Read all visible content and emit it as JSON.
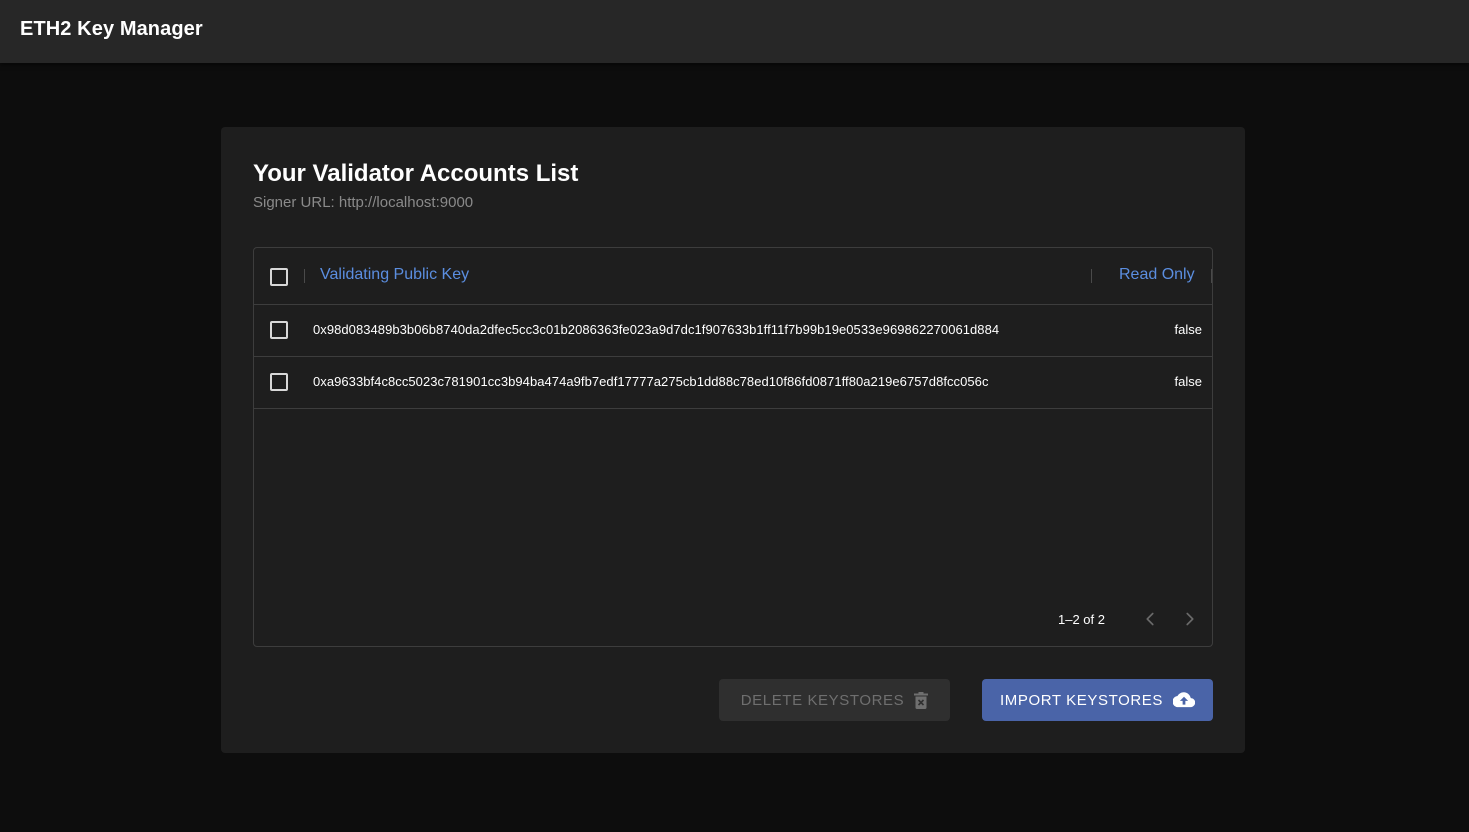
{
  "app": {
    "title": "ETH2 Key Manager"
  },
  "card": {
    "title": "Your Validator Accounts List",
    "subtitle": "Signer URL: http://localhost:9000"
  },
  "table": {
    "columns": {
      "public_key": "Validating Public Key",
      "read_only": "Read Only"
    },
    "rows": [
      {
        "public_key": "0x98d083489b3b06b8740da2dfec5cc3c01b2086363fe023a9d7dc1f907633b1ff11f7b99b19e0533e969862270061d884",
        "read_only": "false",
        "selected": false
      },
      {
        "public_key": "0xa9633bf4c8cc5023c781901cc3b94ba474a9fb7edf17777a275cb1dd88c78ed10f86fd0871ff80a219e6757d8fcc056c",
        "read_only": "false",
        "selected": false
      }
    ],
    "pagination": "1–2 of 2",
    "select_all_checked": false
  },
  "buttons": {
    "delete": {
      "label": "DELETE KEYSTORES",
      "icon": "trash-icon",
      "disabled": true
    },
    "import": {
      "label": "IMPORT KEYSTORES",
      "icon": "cloud-upload-icon"
    }
  },
  "colors": {
    "accent": "#5b8ee0",
    "primary_button": "#4a64a8",
    "background": "#0d0d0d",
    "surface": "#1e1e1e",
    "appbar": "#272727"
  }
}
